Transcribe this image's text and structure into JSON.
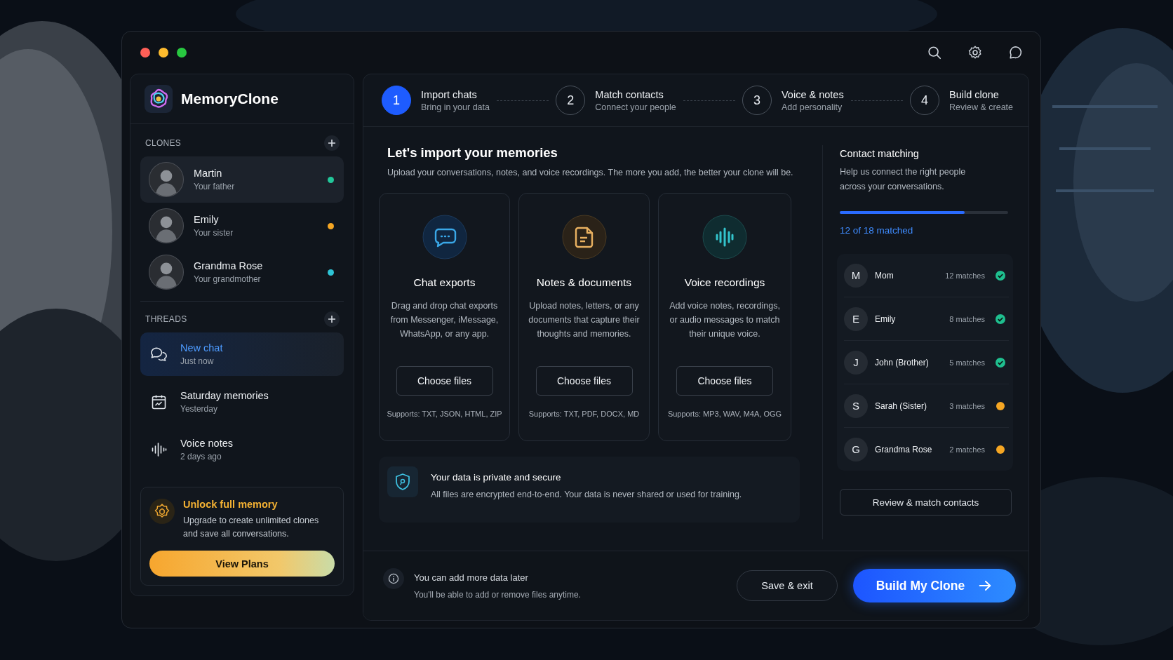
{
  "app": {
    "name": "MemoryClone"
  },
  "clones": {
    "heading": "CLONES",
    "items": [
      {
        "name": "Martin",
        "relation": "Your father",
        "color": "#22c79a",
        "selected": true
      },
      {
        "name": "Emily",
        "relation": "Your sister",
        "color": "#f5a623",
        "selected": false
      },
      {
        "name": "Grandma Rose",
        "relation": "Your grandmother",
        "color": "#2ec4d6",
        "selected": false
      }
    ]
  },
  "threads": {
    "heading": "THREADS",
    "items": [
      {
        "kind": "chat",
        "title": "New chat",
        "time": "Just now",
        "selected": true
      },
      {
        "kind": "calendar",
        "title": "Saturday memories",
        "time": "Yesterday",
        "selected": false
      },
      {
        "kind": "voice",
        "title": "Voice notes",
        "time": "2 days ago",
        "selected": false
      }
    ]
  },
  "upgrade": {
    "title": "Unlock full memory",
    "text": "Upgrade to create unlimited clones and save all conversations.",
    "button": "View Plans"
  },
  "steps": [
    {
      "number": "1",
      "title": "Import chats",
      "subtitle": "Bring in your data",
      "selected": true
    },
    {
      "number": "2",
      "title": "Match contacts",
      "subtitle": "Connect your people",
      "selected": false
    },
    {
      "number": "3",
      "title": "Voice & notes",
      "subtitle": "Add personality",
      "selected": false
    },
    {
      "number": "4",
      "title": "Build clone",
      "subtitle": "Review & create",
      "selected": false
    }
  ],
  "import": {
    "title": "Let's import your memories",
    "subtitle": "Upload your conversations, notes, and voice recordings. The more you add, the better your clone will be.",
    "cards": [
      {
        "kind": "chat",
        "title": "Chat exports",
        "text": "Drag and drop chat exports from Messenger, iMessage, WhatsApp, or any app.",
        "button": "Choose files",
        "supports": "Supports: TXT, JSON, HTML, ZIP"
      },
      {
        "kind": "notes",
        "title": "Notes & documents",
        "text": "Upload notes, letters, or any documents that capture their thoughts and memories.",
        "button": "Choose files",
        "supports": "Supports: TXT, PDF, DOCX, MD"
      },
      {
        "kind": "voice",
        "title": "Voice recordings",
        "text": "Add voice notes, recordings, or audio messages to match their unique voice.",
        "button": "Choose files",
        "supports": "Supports: MP3, WAV, M4A, OGG"
      }
    ],
    "privacy": {
      "title": "Your data is private and secure",
      "text": "All files are encrypted end-to-end. Your data is never shared or used for training."
    }
  },
  "matching": {
    "title": "Contact matching",
    "text": "Help us connect the right people across your conversations.",
    "level": 0.74,
    "progress_label": "12 of 18 matched",
    "contacts": [
      {
        "initial": "M",
        "name": "Mom",
        "matches": "12 matches",
        "matched": true
      },
      {
        "initial": "E",
        "name": "Emily",
        "matches": "8 matches",
        "matched": true
      },
      {
        "initial": "J",
        "name": "John (Brother)",
        "matches": "5 matches",
        "matched": true
      },
      {
        "initial": "S",
        "name": "Sarah (Sister)",
        "matches": "3 matches",
        "matched": false
      },
      {
        "initial": "G",
        "name": "Grandma Rose",
        "matches": "2 matches",
        "matched": false
      }
    ],
    "button": "Review & match contacts"
  },
  "footer": {
    "title": "You can add more data later",
    "text": "You'll be able to add or remove files anytime.",
    "secondary_button": "Save & exit",
    "primary_button": "Build My Clone"
  }
}
